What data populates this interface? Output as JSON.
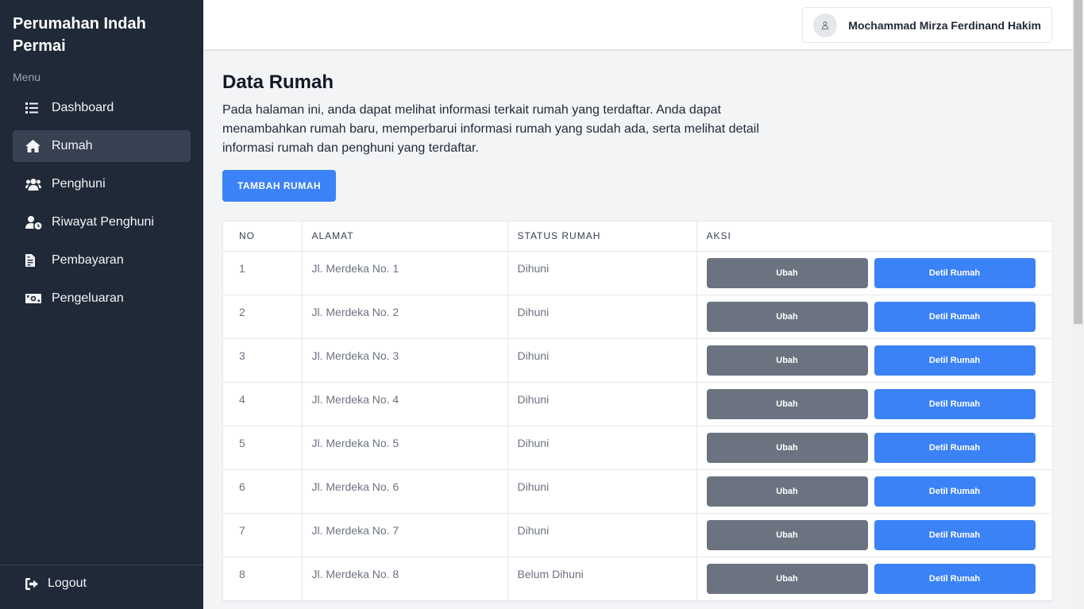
{
  "sidebar": {
    "brand": "Perumahan Indah Permai",
    "menu_label": "Menu",
    "items": [
      {
        "label": "Dashboard",
        "icon": "list-icon"
      },
      {
        "label": "Rumah",
        "icon": "home-icon",
        "active": true
      },
      {
        "label": "Penghuni",
        "icon": "users-icon"
      },
      {
        "label": "Riwayat Penghuni",
        "icon": "user-clock-icon"
      },
      {
        "label": "Pembayaran",
        "icon": "file-invoice-icon"
      },
      {
        "label": "Pengeluaran",
        "icon": "money-bill-icon"
      }
    ],
    "logout_label": "Logout"
  },
  "header": {
    "user_name": "Mochammad Mirza Ferdinand Hakim"
  },
  "main": {
    "title": "Data Rumah",
    "description": "Pada halaman ini, anda dapat melihat informasi terkait rumah yang terdaftar. Anda dapat menambahkan rumah baru, memperbarui informasi rumah yang sudah ada, serta melihat detail informasi rumah dan penghuni yang terdaftar.",
    "add_button": "TAMBAH RUMAH"
  },
  "table": {
    "headers": [
      "NO",
      "ALAMAT",
      "STATUS RUMAH",
      "AKSI"
    ],
    "edit_label": "Ubah",
    "detail_label": "Detil Rumah",
    "rows": [
      {
        "no": "1",
        "alamat": "Jl. Merdeka No. 1",
        "status": "Dihuni"
      },
      {
        "no": "2",
        "alamat": "Jl. Merdeka No. 2",
        "status": "Dihuni"
      },
      {
        "no": "3",
        "alamat": "Jl. Merdeka No. 3",
        "status": "Dihuni"
      },
      {
        "no": "4",
        "alamat": "Jl. Merdeka No. 4",
        "status": "Dihuni"
      },
      {
        "no": "5",
        "alamat": "Jl. Merdeka No. 5",
        "status": "Dihuni"
      },
      {
        "no": "6",
        "alamat": "Jl. Merdeka No. 6",
        "status": "Dihuni"
      },
      {
        "no": "7",
        "alamat": "Jl. Merdeka No. 7",
        "status": "Dihuni"
      },
      {
        "no": "8",
        "alamat": "Jl. Merdeka No. 8",
        "status": "Belum Dihuni"
      }
    ]
  },
  "colors": {
    "sidebar_bg": "#1f2937",
    "active_item_bg": "#374151",
    "primary": "#3b82f6",
    "secondary": "#6b7280"
  }
}
